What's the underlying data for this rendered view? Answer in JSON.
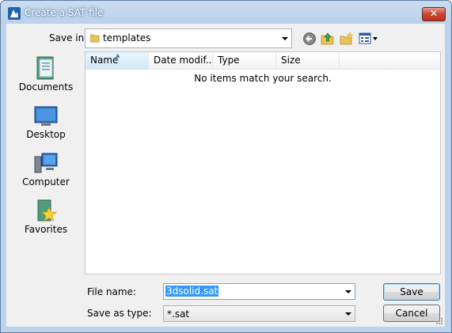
{
  "window": {
    "title": "Create a SAT file",
    "close_symbol": "✕"
  },
  "savein": {
    "label": "Save in:",
    "folder": "templates"
  },
  "toolbar": {
    "icons": [
      "back-icon",
      "up-folder-icon",
      "new-folder-icon",
      "views-menu-icon"
    ]
  },
  "places": [
    {
      "label": "Documents",
      "icon": "documents-icon"
    },
    {
      "label": "Desktop",
      "icon": "desktop-icon"
    },
    {
      "label": "Computer",
      "icon": "computer-icon"
    },
    {
      "label": "Favorites",
      "icon": "favorites-icon"
    }
  ],
  "filelist": {
    "columns": [
      "Name",
      "Date modif...",
      "Type",
      "Size"
    ],
    "sorted_column": "Name",
    "empty_message": "No items match your search."
  },
  "filename": {
    "label": "File name:",
    "value": "3dsolid.sat"
  },
  "savetype": {
    "label": "Save as type:",
    "value": "*.sat"
  },
  "buttons": {
    "save": "Save",
    "cancel": "Cancel"
  }
}
